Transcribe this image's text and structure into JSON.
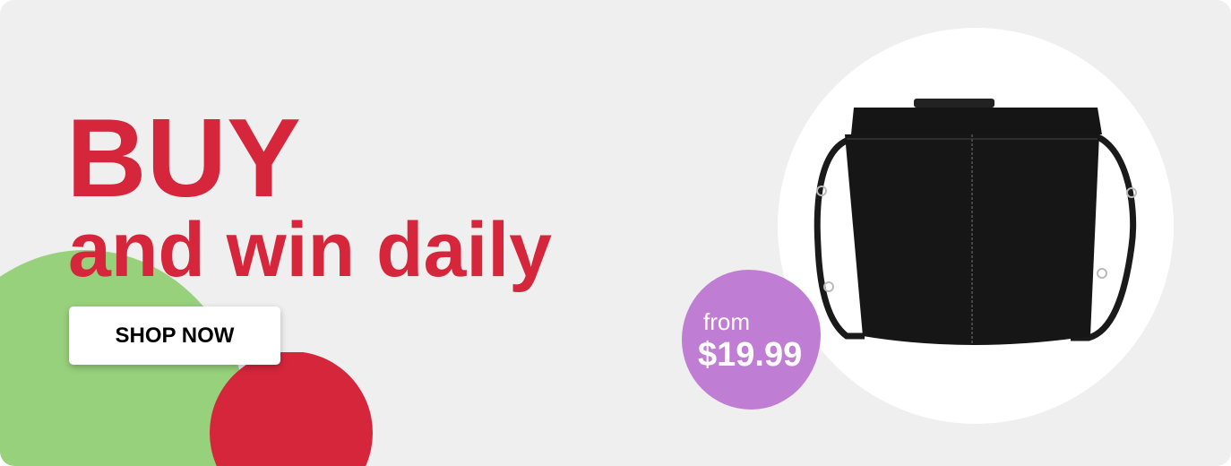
{
  "headline": "BUY",
  "subheadline": "and win daily",
  "cta": {
    "label": "SHOP NOW"
  },
  "price_badge": {
    "prefix": "from",
    "price": "$19.99"
  },
  "product": {
    "icon": "black-leather-crossbody-bag-image"
  },
  "colors": {
    "background": "#efefef",
    "accent_red": "#d5263b",
    "green": "#98d17c",
    "badge_purple": "#c07dd4"
  }
}
